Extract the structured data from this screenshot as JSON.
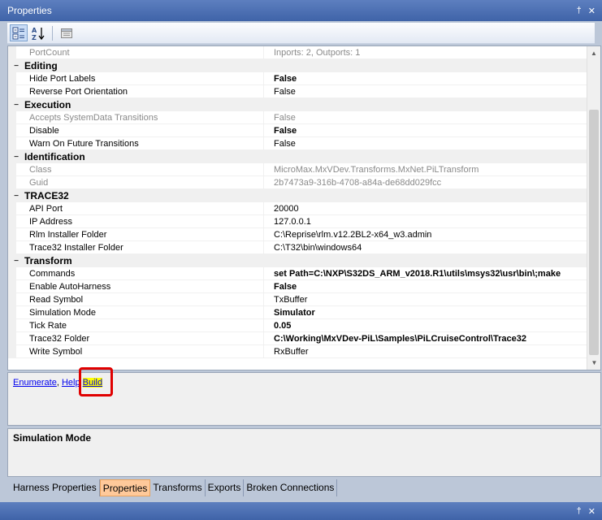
{
  "window": {
    "title": "Properties",
    "pin_glyph": "†",
    "close_glyph": "✕"
  },
  "toolbar": {
    "categorized_icon": "categorized-view-icon",
    "alphabetical_icon": "alphabetical-sort-icon",
    "property_pages_icon": "property-pages-icon"
  },
  "grid": {
    "rows": [
      {
        "type": "prop",
        "name": "PortCount",
        "value": "Inports: 2, Outports: 1",
        "dim": true,
        "bold": false
      },
      {
        "type": "cat",
        "label": "Editing"
      },
      {
        "type": "prop",
        "name": "Hide Port Labels",
        "value": "False",
        "dim": false,
        "bold": true
      },
      {
        "type": "prop",
        "name": "Reverse Port Orientation",
        "value": "False",
        "dim": false,
        "bold": false
      },
      {
        "type": "cat",
        "label": "Execution"
      },
      {
        "type": "prop",
        "name": "Accepts SystemData Transitions",
        "value": "False",
        "dim": true,
        "bold": false
      },
      {
        "type": "prop",
        "name": "Disable",
        "value": "False",
        "dim": false,
        "bold": true
      },
      {
        "type": "prop",
        "name": "Warn On Future Transitions",
        "value": "False",
        "dim": false,
        "bold": false
      },
      {
        "type": "cat",
        "label": "Identification"
      },
      {
        "type": "prop",
        "name": "Class",
        "value": "MicroMax.MxVDev.Transforms.MxNet.PiLTransform",
        "dim": true,
        "bold": false
      },
      {
        "type": "prop",
        "name": "Guid",
        "value": "2b7473a9-316b-4708-a84a-de68dd029fcc",
        "dim": true,
        "bold": false
      },
      {
        "type": "cat",
        "label": "TRACE32"
      },
      {
        "type": "prop",
        "name": "API Port",
        "value": "20000",
        "dim": false,
        "bold": false
      },
      {
        "type": "prop",
        "name": "IP Address",
        "value": "127.0.0.1",
        "dim": false,
        "bold": false
      },
      {
        "type": "prop",
        "name": "Rlm Installer Folder",
        "value": "C:\\Reprise\\rlm.v12.2BL2-x64_w3.admin",
        "dim": false,
        "bold": false
      },
      {
        "type": "prop",
        "name": "Trace32 Installer Folder",
        "value": "C:\\T32\\bin\\windows64",
        "dim": false,
        "bold": false
      },
      {
        "type": "cat",
        "label": "Transform"
      },
      {
        "type": "prop",
        "name": "Commands",
        "value": "set Path=C:\\NXP\\S32DS_ARM_v2018.R1\\utils\\msys32\\usr\\bin\\;make",
        "dim": false,
        "bold": true
      },
      {
        "type": "prop",
        "name": "Enable AutoHarness",
        "value": "False",
        "dim": false,
        "bold": true
      },
      {
        "type": "prop",
        "name": "Read Symbol",
        "value": "TxBuffer",
        "dim": false,
        "bold": false
      },
      {
        "type": "prop",
        "name": "Simulation Mode",
        "value": "Simulator",
        "dim": false,
        "bold": true
      },
      {
        "type": "prop",
        "name": "Tick Rate",
        "value": "0.05",
        "dim": false,
        "bold": true
      },
      {
        "type": "prop",
        "name": "Trace32 Folder",
        "value": "C:\\Working\\MxVDev-PiL\\Samples\\PiLCruiseControl\\Trace32",
        "dim": false,
        "bold": true
      },
      {
        "type": "prop",
        "name": "Write Symbol",
        "value": "RxBuffer",
        "dim": false,
        "bold": false
      }
    ]
  },
  "commands": {
    "enumerate": "Enumerate",
    "separator": ",",
    "help": "Help",
    "build": "Build"
  },
  "description": {
    "title": "Simulation Mode"
  },
  "tabs": [
    {
      "label": "Harness Properties",
      "active": false
    },
    {
      "label": "Properties",
      "active": true
    },
    {
      "label": "Transforms",
      "active": false
    },
    {
      "label": "Exports",
      "active": false
    },
    {
      "label": "Broken Connections",
      "active": false
    }
  ],
  "colors": {
    "accent": "#3f63a8",
    "active_tab": "#ffc99a",
    "highlight": "#ffff00",
    "callout": "#e00000"
  }
}
